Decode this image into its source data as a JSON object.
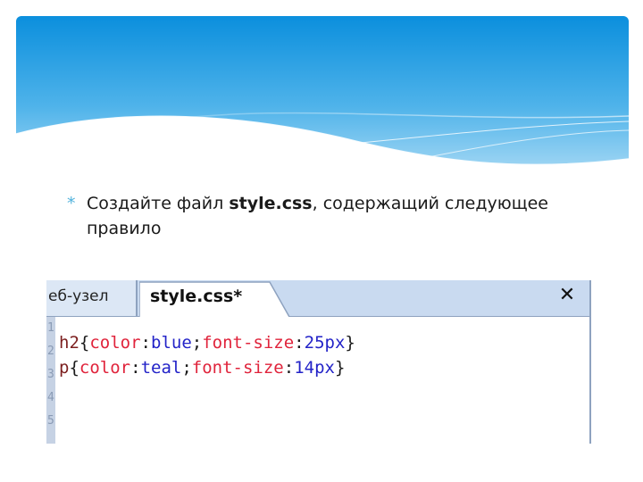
{
  "slide": {
    "bullet_symbol": "*",
    "bullet_prefix": "Создайте файл ",
    "bullet_bold": "style.css",
    "bullet_suffix": ", содержащий следующее правило"
  },
  "editor": {
    "prev_tab_label": "еб-узел",
    "active_tab_label": "style.css*",
    "close_symbol": "✕",
    "line_numbers": [
      "1",
      "2",
      "3",
      "4",
      "5"
    ],
    "lines": [
      {
        "selector": "h2",
        "open": "{",
        "p1": "color",
        "c1": ":",
        "v1": "blue",
        "sep": ";",
        "p2": "font-size",
        "c2": ":",
        "v2": "25px",
        "close": "}"
      },
      {
        "selector": "p",
        "open": "{",
        "p1": "color",
        "c1": ":",
        "v1": "teal",
        "sep": ";",
        "p2": "font-size",
        "c2": ":",
        "v2": "14px",
        "close": "}"
      }
    ]
  },
  "colors": {
    "header_top": "#0b8fdd",
    "header_bottom": "#aedcf5",
    "bullet_accent": "#52b3dc",
    "tab_background": "#c9daf0",
    "selector": "#7c1f1f",
    "property": "#e0233b",
    "value": "#2323c8"
  }
}
